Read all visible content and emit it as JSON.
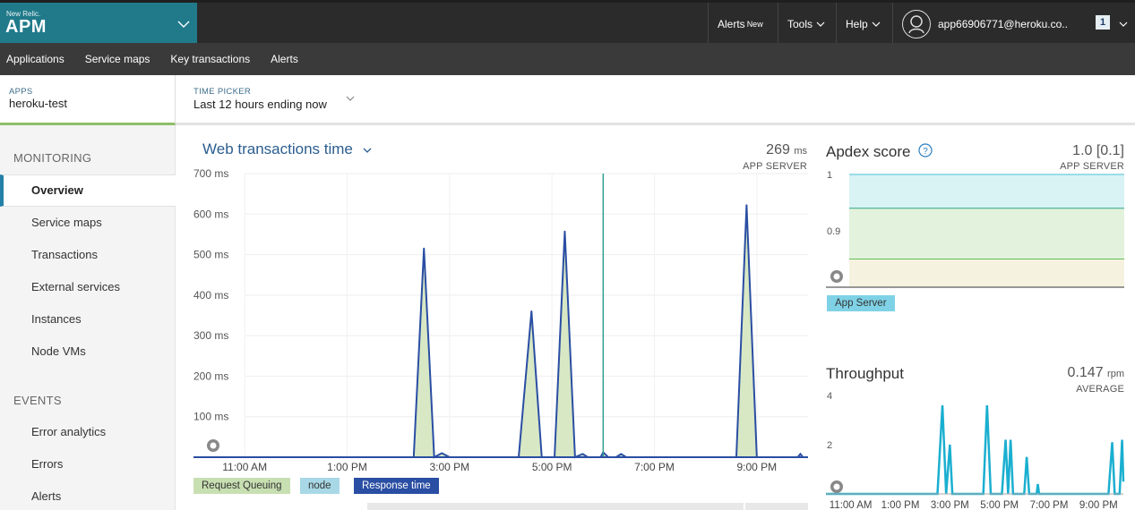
{
  "topbar": {
    "brand_small": "New Relic.",
    "brand_big": "APM",
    "alerts_label": "Alerts",
    "alerts_new": "New",
    "tools_label": "Tools",
    "help_label": "Help",
    "user_email": "app66906771@heroku.co..",
    "notification_count": "1",
    "brand_color": "#207a8a"
  },
  "subnav": {
    "items": [
      "Applications",
      "Service maps",
      "Key transactions",
      "Alerts"
    ]
  },
  "context": {
    "apps_label": "APPS",
    "app_name": "heroku-test",
    "timepicker_label": "TIME PICKER",
    "timepicker_value": "Last 12 hours ending now"
  },
  "sidebar": {
    "monitoring_label": "MONITORING",
    "monitoring_items": [
      "Overview",
      "Service maps",
      "Transactions",
      "External services",
      "Instances",
      "Node VMs"
    ],
    "events_label": "EVENTS",
    "events_items": [
      "Error analytics",
      "Errors",
      "Alerts"
    ],
    "active": "Overview"
  },
  "web_chart": {
    "title": "Web transactions time",
    "value": "269",
    "unit": "ms",
    "subtitle": "APP SERVER",
    "legend": [
      "Request Queuing",
      "node",
      "Response time"
    ]
  },
  "apdex": {
    "title": "Apdex score",
    "value": "1.0 [0.1]",
    "subtitle": "APP SERVER",
    "legend": "App Server"
  },
  "throughput": {
    "title": "Throughput",
    "value": "0.147",
    "unit": "rpm",
    "subtitle": "AVERAGE"
  },
  "chart_data": [
    {
      "type": "line",
      "ylabel_unit": "ms",
      "ylim": [
        0,
        700
      ],
      "y_ticks": [
        "700 ms",
        "600 ms",
        "500 ms",
        "400 ms",
        "300 ms",
        "200 ms",
        "100 ms"
      ],
      "x_ticks": [
        "11:00 AM",
        "1:00 PM",
        "3:00 PM",
        "5:00 PM",
        "7:00 PM",
        "9:00 PM"
      ],
      "xlim_hours": [
        10.0,
        22.0
      ],
      "deployment_marker_hour": 18.0,
      "series": [
        {
          "name": "Response time",
          "color": "#2a4ea3",
          "points": [
            [
              10.0,
              0
            ],
            [
              14.3,
              0
            ],
            [
              14.5,
              515
            ],
            [
              14.7,
              0
            ],
            [
              14.85,
              10
            ],
            [
              15.0,
              0
            ],
            [
              16.35,
              0
            ],
            [
              16.6,
              360
            ],
            [
              16.8,
              0
            ],
            [
              17.05,
              0
            ],
            [
              17.25,
              557
            ],
            [
              17.45,
              0
            ],
            [
              17.6,
              8
            ],
            [
              17.7,
              0
            ],
            [
              17.95,
              0
            ],
            [
              18.0,
              12
            ],
            [
              18.1,
              0
            ],
            [
              18.25,
              0
            ],
            [
              18.35,
              8
            ],
            [
              18.45,
              0
            ],
            [
              20.6,
              0
            ],
            [
              20.8,
              622
            ],
            [
              21.0,
              0
            ],
            [
              21.8,
              0
            ],
            [
              21.85,
              8
            ],
            [
              21.9,
              0
            ],
            [
              22.0,
              0
            ]
          ]
        },
        {
          "name": "Request Queuing",
          "color": "#c8dfb2"
        },
        {
          "name": "node",
          "color": "#a8d8e6"
        }
      ]
    },
    {
      "type": "area",
      "y_ticks": [
        "1",
        "0.9"
      ],
      "ylim": [
        0.8,
        1.0
      ],
      "series": [
        {
          "name": "App Server",
          "values": [
            1,
            1,
            1,
            1,
            1,
            1,
            1,
            1,
            1,
            1
          ]
        }
      ],
      "thresholds": [
        0.94,
        0.85
      ]
    },
    {
      "type": "line",
      "ylim": [
        0,
        4
      ],
      "y_ticks": [
        "4",
        "2"
      ],
      "x_ticks": [
        "11:00 AM",
        "1:00 PM",
        "3:00 PM",
        "5:00 PM",
        "7:00 PM",
        "9:00 PM"
      ],
      "xlim_hours": [
        10.0,
        22.0
      ],
      "series": [
        {
          "name": "Throughput",
          "color": "#1aafd0",
          "points": [
            [
              10.0,
              0
            ],
            [
              14.5,
              0
            ],
            [
              14.7,
              3.6
            ],
            [
              14.85,
              0
            ],
            [
              15.0,
              2
            ],
            [
              15.1,
              0
            ],
            [
              16.35,
              0
            ],
            [
              16.5,
              3.6
            ],
            [
              16.65,
              0
            ],
            [
              17.1,
              0
            ],
            [
              17.25,
              2.2
            ],
            [
              17.35,
              0
            ],
            [
              17.45,
              2.2
            ],
            [
              17.55,
              0
            ],
            [
              18.0,
              0
            ],
            [
              18.1,
              1.5
            ],
            [
              18.2,
              0
            ],
            [
              18.5,
              0
            ],
            [
              18.55,
              0.4
            ],
            [
              18.6,
              0
            ],
            [
              21.4,
              0
            ],
            [
              21.55,
              2.1
            ],
            [
              21.65,
              0
            ],
            [
              21.85,
              0
            ],
            [
              21.95,
              2.2
            ],
            [
              22.0,
              0.5
            ]
          ]
        }
      ]
    }
  ]
}
